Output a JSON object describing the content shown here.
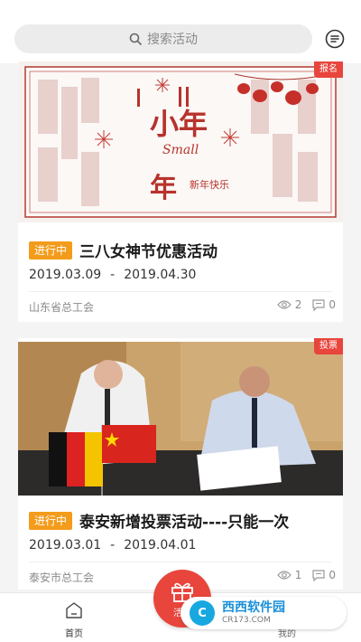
{
  "search": {
    "placeholder": "搜索活动",
    "icon": "search-icon"
  },
  "header": {
    "message_icon": "message-icon"
  },
  "colors": {
    "accent": "#e8453c",
    "status_orange": "#f39c1b",
    "watermark_blue": "#17a8e0"
  },
  "activities": [
    {
      "tag": "报名",
      "status": "进行中",
      "title": "三八女神节优惠活动",
      "start": "2019.03.09",
      "sep": "-",
      "end": "2019.04.30",
      "org": "山东省总工会",
      "views": "2",
      "comments": "0",
      "poster_text": "小年"
    },
    {
      "tag": "投票",
      "status": "进行中",
      "title": "泰安新增投票活动----只能一次",
      "start": "2019.03.01",
      "sep": "-",
      "end": "2019.04.01",
      "org": "泰安市总工会",
      "views": "1",
      "comments": "0"
    }
  ],
  "tabbar": {
    "home": "首页",
    "center": "活动",
    "mine": "我的"
  },
  "watermark": {
    "logo": "C",
    "main": "西西软件园",
    "sub": "CR173.COM"
  }
}
